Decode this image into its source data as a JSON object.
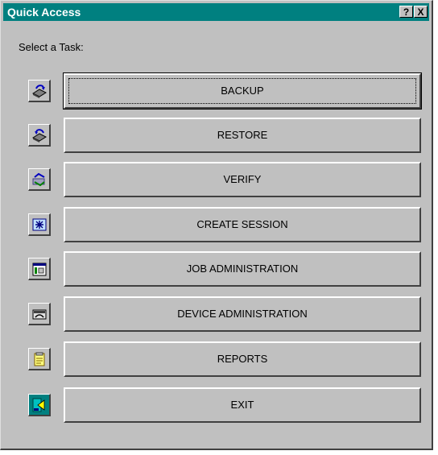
{
  "window": {
    "title": "Quick Access",
    "help_label": "?",
    "close_label": "X",
    "titlebar_color": "#008080"
  },
  "prompt": "Select a Task:",
  "tasks": [
    {
      "label": "BACKUP",
      "icon": "backup-disk-icon"
    },
    {
      "label": "RESTORE",
      "icon": "restore-disk-icon"
    },
    {
      "label": "VERIFY",
      "icon": "verify-icon"
    },
    {
      "label": "CREATE SESSION",
      "icon": "create-session-icon"
    },
    {
      "label": "JOB ADMINISTRATION",
      "icon": "job-administration-icon"
    },
    {
      "label": "DEVICE ADMINISTRATION",
      "icon": "device-administration-icon"
    },
    {
      "label": "REPORTS",
      "icon": "reports-icon"
    },
    {
      "label": "EXIT",
      "icon": "exit-icon"
    }
  ]
}
